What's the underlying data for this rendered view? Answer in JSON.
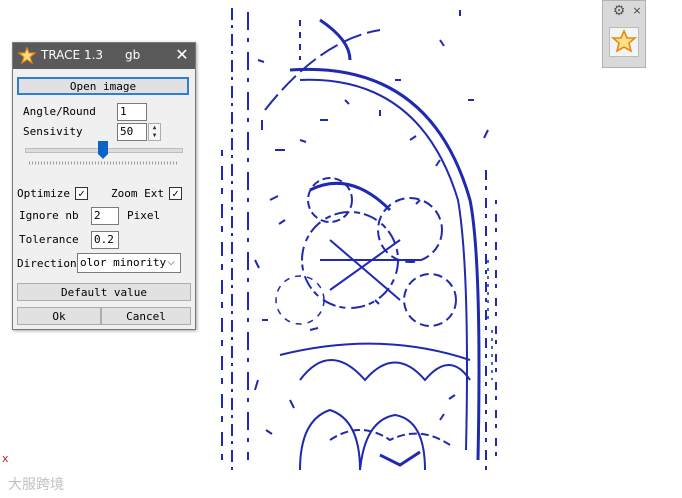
{
  "dialog": {
    "title": "TRACE 1.3",
    "subtitle": "gb",
    "close_glyph": "✕",
    "open_image_label": "Open image",
    "angle_round_label": "Angle/Round",
    "angle_round_value": "1",
    "sensivity_label": "Sensivity",
    "sensivity_value": "50",
    "optimize_label": "Optimize",
    "optimize_checked": true,
    "zoom_ext_label": "Zoom Ext",
    "zoom_ext_checked": true,
    "ignore_nb_label": "Ignore nb",
    "ignore_nb_value": "2",
    "pixel_label": "Pixel",
    "tolerance_label": "Tolerance",
    "tolerance_value": "0.2",
    "direction_label": "Direction",
    "direction_value": "olor minority",
    "default_value_label": "Default value",
    "ok_label": "Ok",
    "cancel_label": "Cancel",
    "slider_fraction": 0.5
  },
  "palette": {
    "gear_glyph": "⚙",
    "close_glyph": "×",
    "tool_icon": "star-tool-icon"
  },
  "canvas": {
    "stroke_color": "#1f2ab0",
    "corner_mark": "x",
    "watermark": "大服跨境"
  },
  "colors": {
    "titlebar": "#5a5a5a",
    "accent": "#2f7fd0"
  }
}
